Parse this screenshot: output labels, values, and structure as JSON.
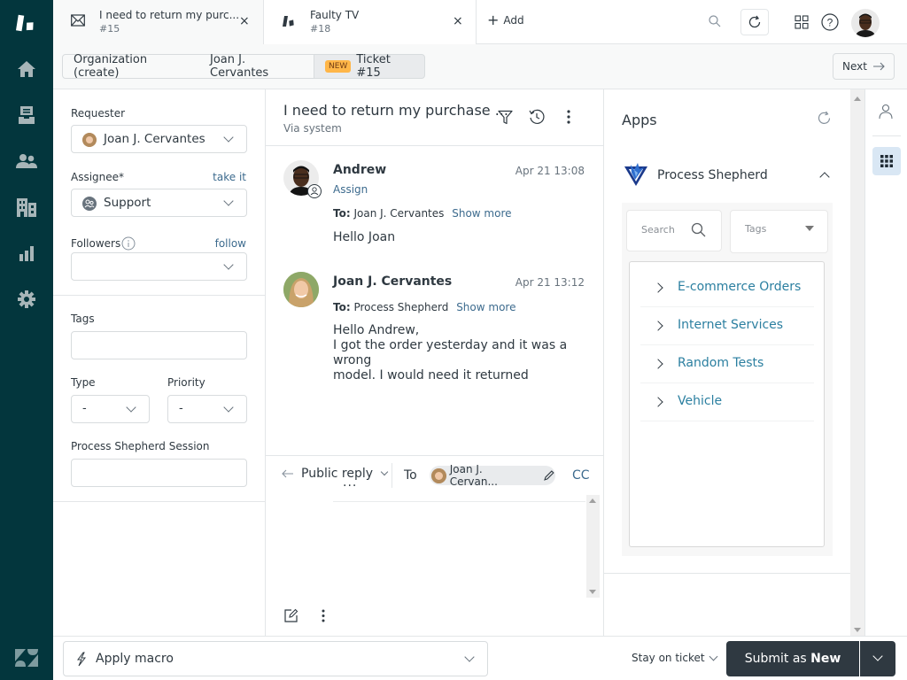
{
  "nav": {
    "items": [
      {
        "name": "zendesk-logo-icon"
      },
      {
        "name": "home-icon"
      },
      {
        "name": "views-icon"
      },
      {
        "name": "customers-icon"
      },
      {
        "name": "organizations-icon"
      },
      {
        "name": "reporting-icon"
      },
      {
        "name": "admin-gear-icon"
      }
    ],
    "bottom": "zendesk-brand-icon"
  },
  "tabs": [
    {
      "title": "I need to return my purc...",
      "subtitle": "#15",
      "icon": "mail-icon",
      "active": true
    },
    {
      "title": "Faulty TV",
      "subtitle": "#18",
      "icon": "zendesk-ticket-icon",
      "active": false
    }
  ],
  "topbar": {
    "add_label": "Add"
  },
  "breadcrumbs": [
    {
      "label": "Organization (create)"
    },
    {
      "label": "Joan J. Cervantes"
    },
    {
      "badge": "NEW",
      "label": "Ticket #15"
    }
  ],
  "next_label": "Next",
  "properties": {
    "requester_label": "Requester",
    "requester_value": "Joan J. Cervantes",
    "assignee_label": "Assignee*",
    "assignee_link": "take it",
    "assignee_value": "Support",
    "followers_label": "Followers",
    "followers_link": "follow",
    "followers_value": "",
    "tags_label": "Tags",
    "tags_value": "",
    "type_label": "Type",
    "type_value": "-",
    "priority_label": "Priority",
    "priority_value": "-",
    "session_label": "Process Shepherd Session",
    "session_value": ""
  },
  "conversation": {
    "title": "I need to return my purchase ...",
    "via": "Via system",
    "messages": [
      {
        "author": "Andrew",
        "time": "Apr 21 13:08",
        "assign": "Assign",
        "to_label": "To:",
        "to": "Joan J. Cervantes",
        "show_more": "Show more",
        "body": [
          "Hello Joan"
        ]
      },
      {
        "author": "Joan J. Cervantes",
        "time": "Apr 21 13:12",
        "to_label": "To:",
        "to": "Process Shepherd",
        "show_more": "Show more",
        "body": [
          "Hello Andrew,",
          "I got the order yesterday and it was a wrong",
          "model. I would need it returned"
        ]
      }
    ],
    "more": "..."
  },
  "composer": {
    "reply_type": "Public reply",
    "to_label": "To",
    "recipient": "Joan J. Cervan...",
    "cc": "CC",
    "body": ""
  },
  "apps": {
    "title": "Apps",
    "app_name": "Process Shepherd",
    "search_placeholder": "Search",
    "tags_placeholder": "Tags",
    "items": [
      "E-commerce Orders",
      "Internet Services",
      "Random Tests",
      "Vehicle"
    ]
  },
  "footer": {
    "macro_label": "Apply macro",
    "stay_label": "Stay on ticket",
    "submit_prefix": "Submit as ",
    "submit_status": "New"
  }
}
